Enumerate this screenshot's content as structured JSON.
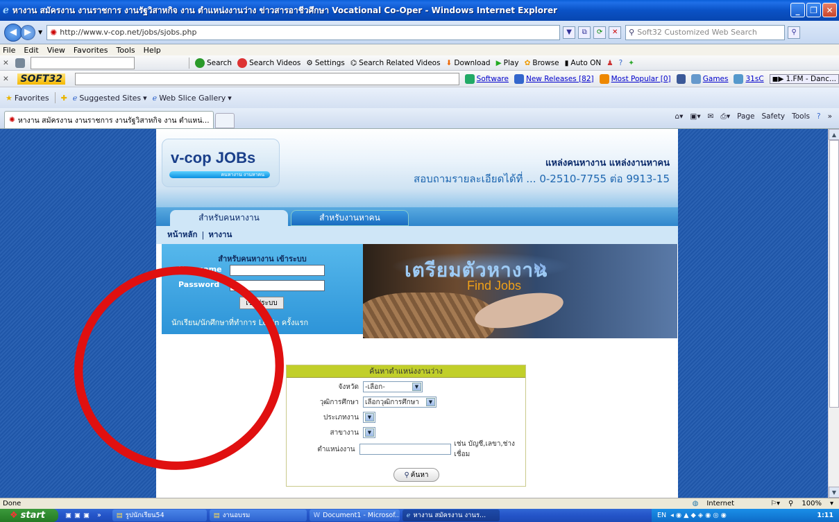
{
  "window": {
    "title": "หางาน สมัครงาน งานราชการ งานรัฐวิสาหกิจ งาน ตำแหน่งงานว่าง ข่าวสารอาชีวศึกษา Vocational Co-Oper - Windows Internet Explorer"
  },
  "address": {
    "url": "http://www.v-cop.net/jobs/sjobs.php",
    "search_placeholder": "Soft32 Customized Web Search"
  },
  "menu": [
    "File",
    "Edit",
    "View",
    "Favorites",
    "Tools",
    "Help"
  ],
  "toolbar1": {
    "search": "Search",
    "search_videos": "Search Videos",
    "settings": "Settings",
    "related": "Search Related Videos",
    "download": "Download",
    "play": "Play",
    "browse": "Browse",
    "auto_on": "Auto ON"
  },
  "toolbar2": {
    "logo": "SOFT32",
    "software": "Software",
    "new_releases": "New Releases [82]",
    "most_popular": "Most Popular [0]",
    "games": "Games",
    "temp": "31sC",
    "radio": "1.FM - Danc..."
  },
  "favorites_bar": {
    "favorites": "Favorites",
    "suggested": "Suggested Sites",
    "webslice": "Web Slice Gallery"
  },
  "tab": {
    "title": "หางาน สมัครงาน งานราชการ งานรัฐวิสาหกิจ งาน ตำแหน่...",
    "page": "Page",
    "safety": "Safety",
    "tools": "Tools"
  },
  "site": {
    "logo_text": "v-cop JOBs",
    "logo_sub": "คนหางาน งานหาคน",
    "tagline": "แหล่งคนหางาน แหล่งงานหาคน",
    "contact": "สอบถามรายละเอียดได้ที่ ... 0-2510-7755 ต่อ 9913-15",
    "tab_seekers": "สำหรับคนหางาน",
    "tab_employers": "สำหรับงานหาคน",
    "nav_home": "หน้าหลัก",
    "nav_sep": "|",
    "nav_jobs": "หางาน",
    "login_title": "สำหรับคนหางาน เข้าระบบ",
    "username_label": "Username",
    "password_label": "Password",
    "login_button": "เข้าสู่ระบบ",
    "first_login": "นักเรียน/นักศึกษาที่ทำการ Login ครั้งแรก",
    "banner_title": "เตรียมตัวหางาน",
    "banner_sub": "Find Jobs",
    "search_title": "ค้นหาตำแหน่งงานว่าง",
    "province_label": "จังหวัด",
    "province_value": "-เลือก-",
    "edu_label": "วุฒิการศึกษา",
    "edu_value": "เลือกวุฒิการศึกษา",
    "jobtype_label": "ประเภทงาน",
    "field_label": "สาขางาน",
    "position_label": "ตำแหน่งงาน",
    "position_hint": "เช่น บัญชี,เลขา,ช่างเชื่อม",
    "search_button": "ค้นหา"
  },
  "status": {
    "text": "Done",
    "zone": "Internet",
    "zoom": "100%"
  },
  "taskbar": {
    "start": "start",
    "tasks": [
      "รูปนักเรียน54",
      "งานอบรม",
      "Document1 - Microsof...",
      "หางาน สมัครงาน งานร..."
    ],
    "lang": "EN",
    "time": "1:11"
  }
}
